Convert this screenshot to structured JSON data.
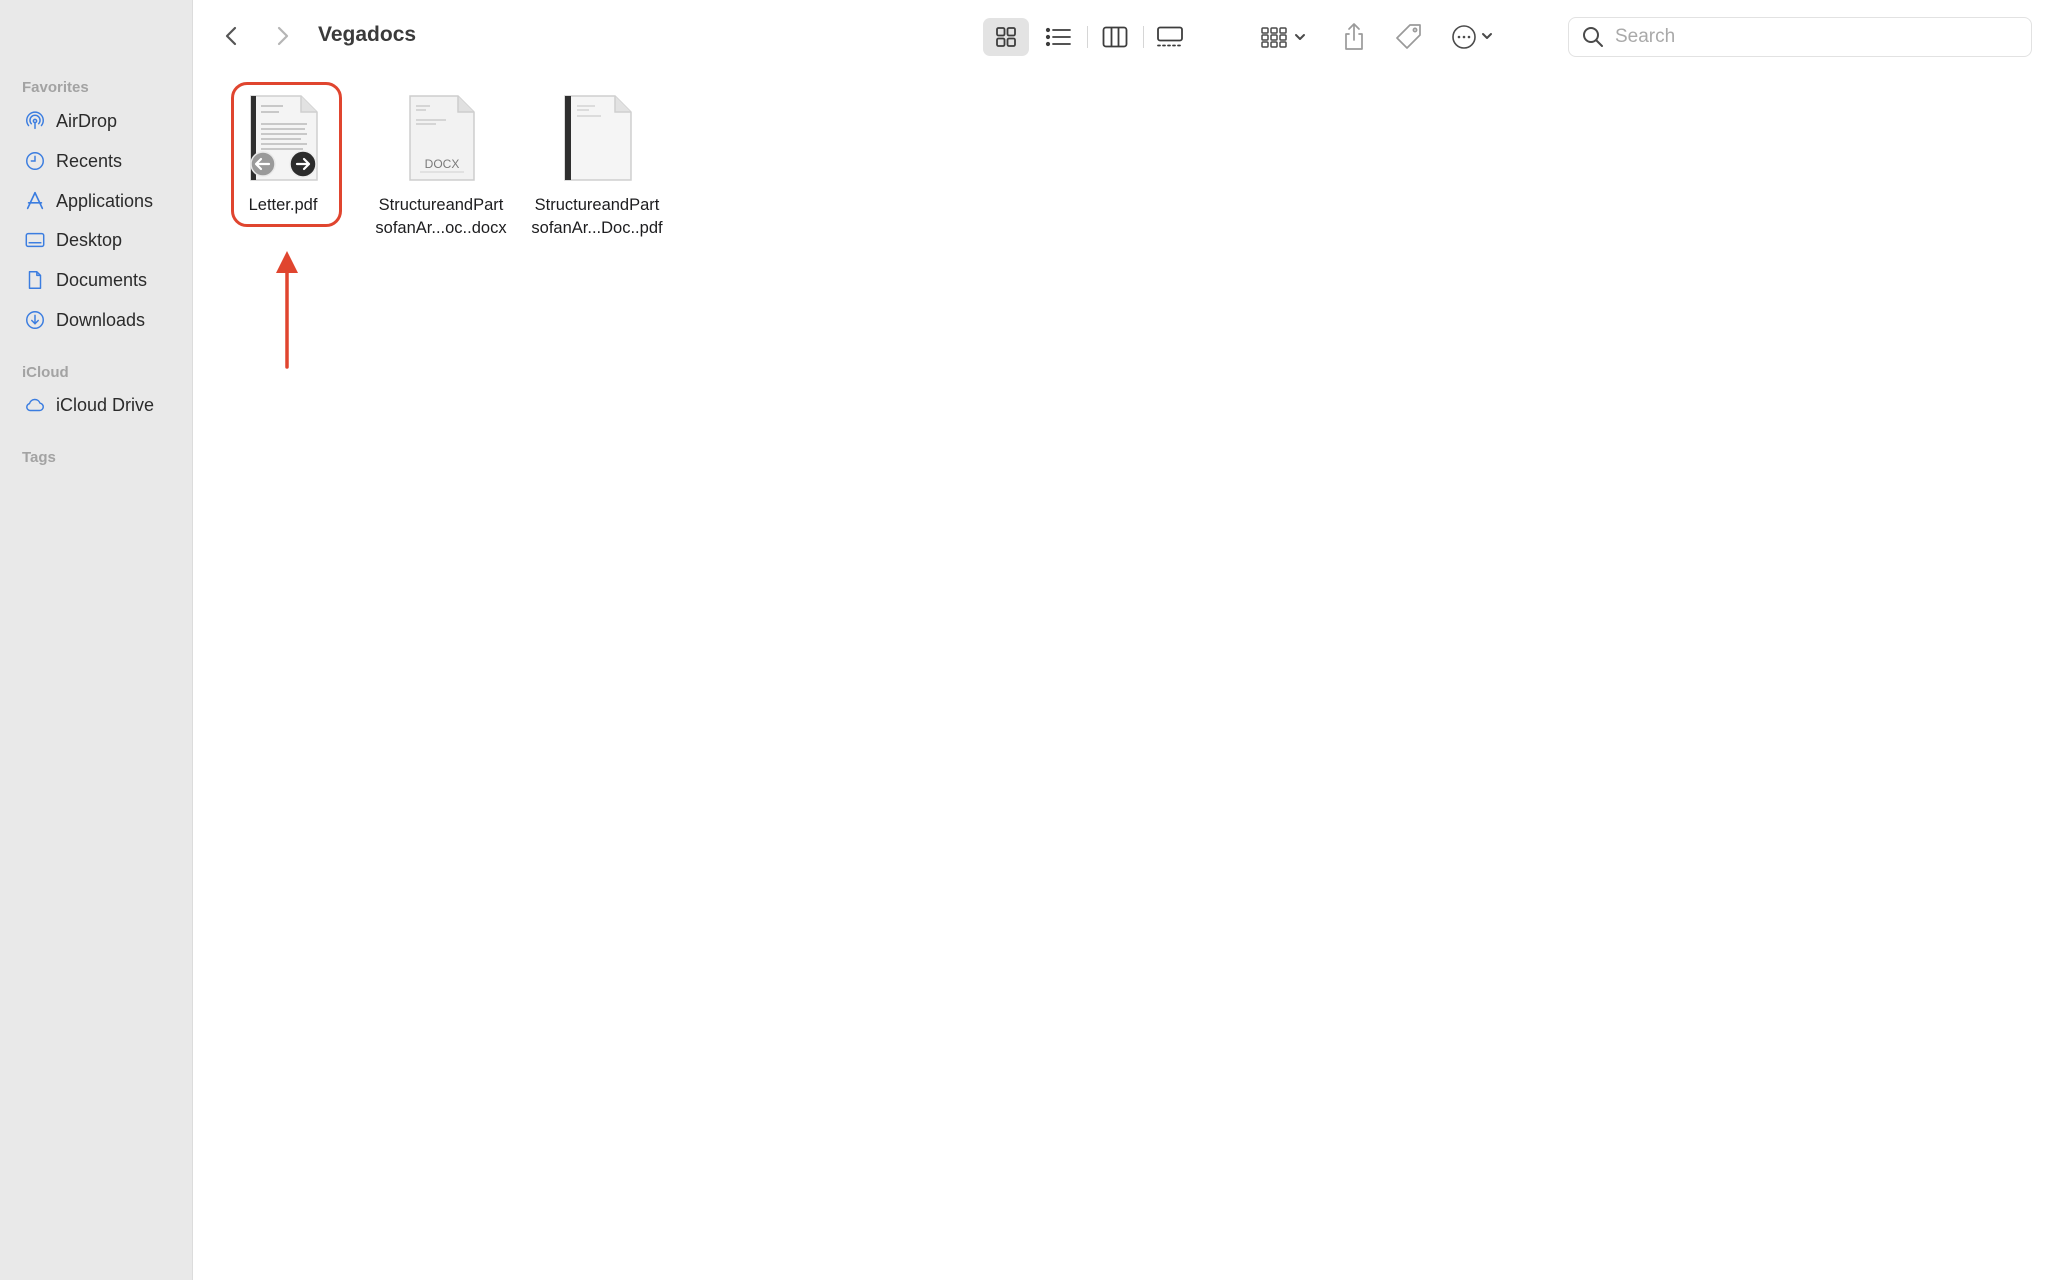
{
  "window": {
    "folder_title": "Vegadocs"
  },
  "sidebar": {
    "favorites_heading": "Favorites",
    "favorites": [
      {
        "label": "AirDrop",
        "icon": "airdrop-icon"
      },
      {
        "label": "Recents",
        "icon": "clock-icon"
      },
      {
        "label": "Applications",
        "icon": "applications-icon"
      },
      {
        "label": "Desktop",
        "icon": "desktop-icon"
      },
      {
        "label": "Documents",
        "icon": "document-icon"
      },
      {
        "label": "Downloads",
        "icon": "download-icon"
      }
    ],
    "icloud_heading": "iCloud",
    "icloud": [
      {
        "label": "iCloud Drive",
        "icon": "cloud-icon"
      }
    ],
    "tags_heading": "Tags"
  },
  "toolbar": {
    "back_icon": "chevron-left-icon",
    "forward_icon": "chevron-right-icon",
    "views": [
      "icon-view-icon",
      "list-view-icon",
      "column-view-icon",
      "gallery-view-icon"
    ],
    "active_view": "icon-view-icon",
    "search": {
      "placeholder": "Search",
      "value": ""
    }
  },
  "files": [
    {
      "name_line1": "Letter.pdf",
      "name_line2": "",
      "type": "pdf-with-arrows",
      "selected": true
    },
    {
      "name_line1": "StructureandPart",
      "name_line2": "sofanAr...oc..docx",
      "type": "docx",
      "badge": "DOCX"
    },
    {
      "name_line1": "StructureandPart",
      "name_line2": "sofanAr...Doc..pdf",
      "type": "pdf"
    }
  ],
  "colors": {
    "sidebar_bg": "#e9e9e9",
    "sidebar_icon": "#3b7de0",
    "annotation": "#e0452f"
  }
}
